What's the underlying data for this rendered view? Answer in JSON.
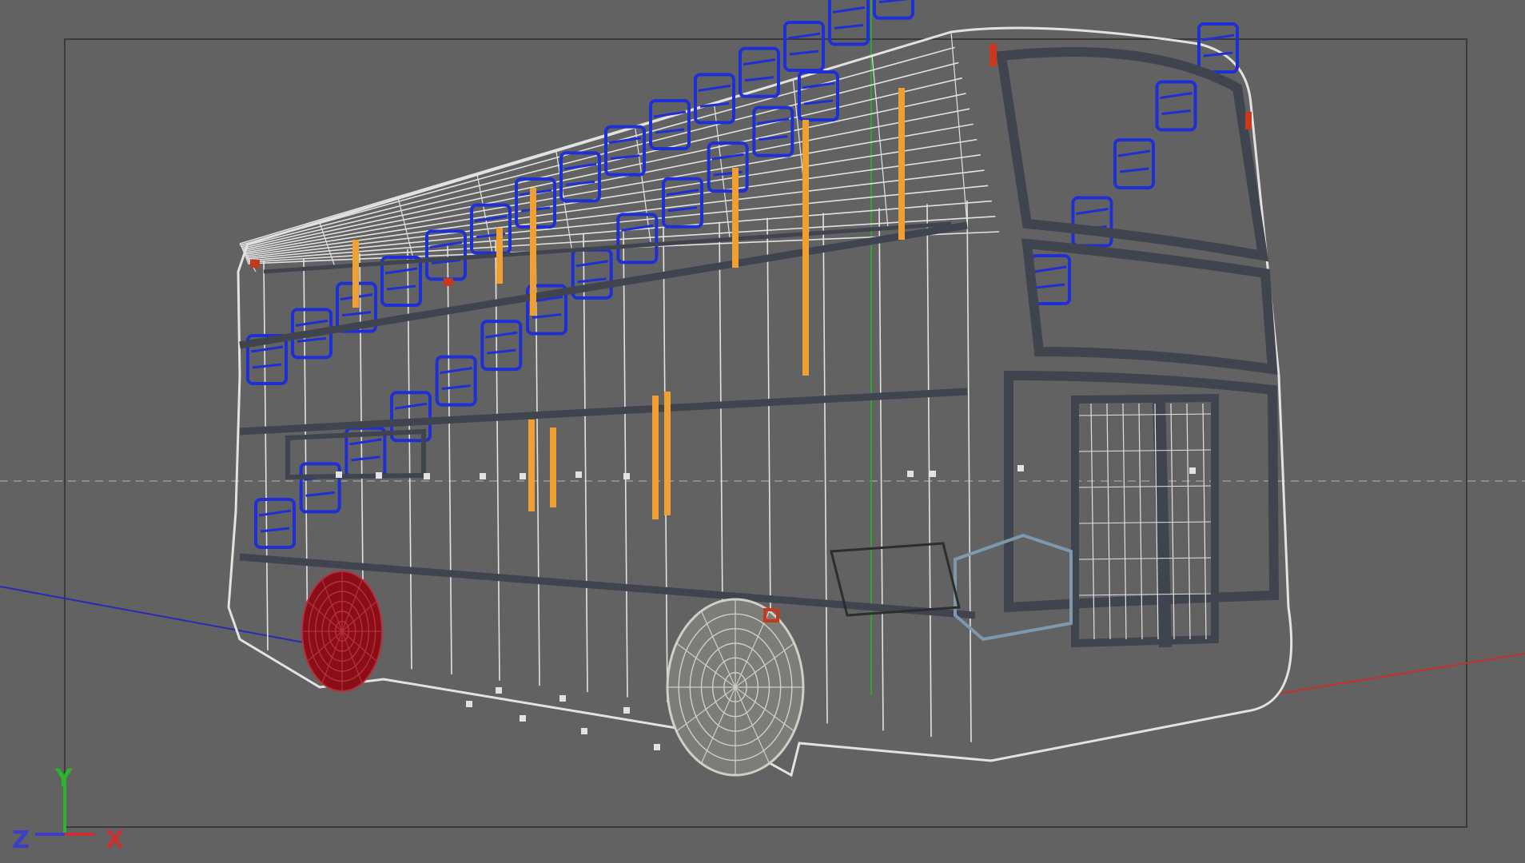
{
  "viewport": {
    "background": "#626262",
    "frame_color": "#3a3a3a",
    "grid_center_line_color": "#8c8c8c"
  },
  "world_axes": {
    "vertical_color": "#2fa52f",
    "x_color": "#c23232",
    "z_color": "#2a2ab5"
  },
  "model": {
    "wire_color": "#e2e2e2",
    "seat_color": "#1f2fd6",
    "pole_color": "#f0a030",
    "frame_color": "#40444e",
    "rear_wheel_color": "#8a0d18",
    "front_wheel_color": "#cfcfc4",
    "marker_color": "#c8381a",
    "engine_color": "#7e98ad"
  },
  "gizmo": {
    "y_label": "Y",
    "z_label": "Z",
    "x_label": "X",
    "y_color": "#2ab52a",
    "x_color": "#c83232",
    "z_color": "#3d3dc9"
  }
}
